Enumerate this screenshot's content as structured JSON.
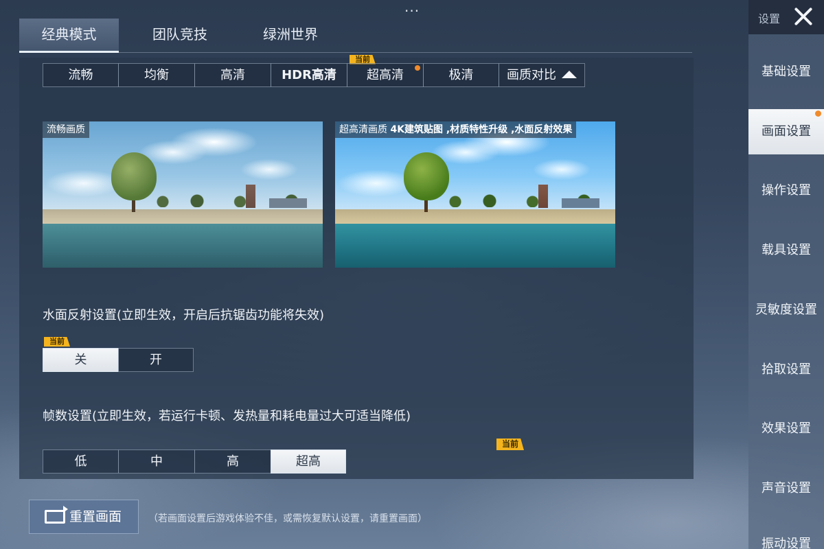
{
  "top_menu": {
    "dots": "···"
  },
  "mode_tabs": [
    {
      "label": "经典模式"
    },
    {
      "label": "团队竞技"
    },
    {
      "label": "绿洲世界"
    }
  ],
  "quality": {
    "options": [
      "流畅",
      "均衡",
      "高清",
      "HDR高清",
      "超高清",
      "极清"
    ],
    "selected": "超高清",
    "compare_label": "画质对比",
    "current_tag": "当前"
  },
  "previews": {
    "left_label": "流畅画质",
    "right_label": "超高清画质",
    "right_desc": "4K建筑贴图 ,材质特性升级 ,水面反射效果"
  },
  "water_reflection": {
    "title": "水面反射设置(立即生效，开启后抗锯齿功能将失效)",
    "options": [
      "关",
      "开"
    ],
    "selected": "关",
    "current_tag": "当前"
  },
  "frame_rate": {
    "title": "帧数设置(立即生效，若运行卡顿、发热量和耗电量过大可适当降低)",
    "options": [
      "低",
      "中",
      "高",
      "超高"
    ],
    "selected": "超高",
    "current_tag": "当前"
  },
  "reset": {
    "button_label": "重置画面",
    "note": "（若画面设置后游戏体验不佳，或需恢复默认设置，请重置画面）"
  },
  "sidebar": {
    "header": "设置",
    "items": [
      {
        "label": "基础设置"
      },
      {
        "label": "画面设置"
      },
      {
        "label": "操作设置"
      },
      {
        "label": "载具设置"
      },
      {
        "label": "灵敏度设置"
      },
      {
        "label": "拾取设置"
      },
      {
        "label": "效果设置"
      },
      {
        "label": "声音设置"
      },
      {
        "label": "振动设置"
      }
    ],
    "active": "画面设置"
  },
  "colors": {
    "accent_tag": "#f5b41e",
    "notify_dot": "#f08b2c",
    "selected_bg": "#f4f6f8"
  }
}
